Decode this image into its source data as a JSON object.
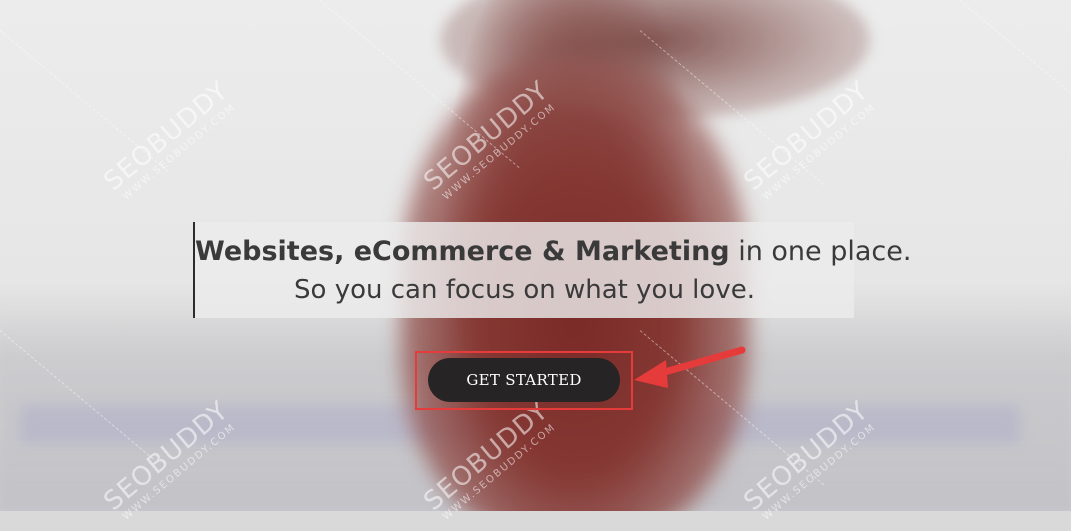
{
  "hero": {
    "headline": {
      "bold_part": "Websites, eCommerce & Marketing",
      "regular_part": " in one place.",
      "subline": "So you can focus on what you love."
    },
    "cta_label": "GET STARTED"
  },
  "watermark": {
    "brand": "SEOBUDDY",
    "domain": "WWW.SEOBUDDY.COM"
  },
  "annotation": {
    "highlight_color": "#e63b3b",
    "arrow_icon": "red-arrow-pointing-left"
  }
}
